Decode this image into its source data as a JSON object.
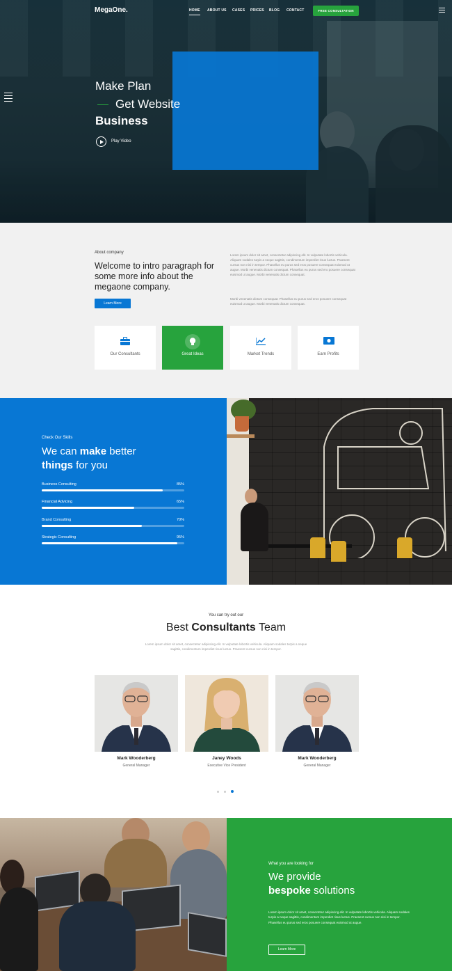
{
  "brand": {
    "logo": "MegaOne."
  },
  "nav": {
    "items": [
      "HOME",
      "ABOUT US",
      "CASES",
      "PRICES",
      "BLOG",
      "CONTACT"
    ],
    "cta": "FREE CONSULTATION"
  },
  "hero": {
    "line1": "Make Plan",
    "line2": "Get Website",
    "line3": "Business",
    "play_label": "Play Video"
  },
  "about": {
    "eyebrow": "About company",
    "heading": "Welcome to intro paragraph for some more info about the megaone company.",
    "button": "Learn More",
    "para1": "Lorem ipsum dolor sit amet, consectetur adipiscing elit. In vulputate lobortis vehicula. Aliquam sodales turpis a neque sagittis, condimentum imperdiet risus luctus. Praesent cursus non nisi in tempor. Phasellus eu purus sed eros posuere consequat euismod ut augue. Morbi venenatis dictum consequat. Phasellus eu purus sed ero posuere consequat euismod ut augue. Morbi venenatis dictum consequat.",
    "para2": "Morbi venenatis dictum consequat. Phasellus eu purus sed eros posuere consequat euismod ut augue. Morbi venenatis dictum consequat.",
    "cards": [
      "Our Consultants",
      "Great Ideas",
      "Market Trends",
      "Earn Profits"
    ]
  },
  "skills": {
    "eyebrow": "Check Our Skills",
    "heading_a": "We can ",
    "heading_b": "make",
    "heading_c": " better",
    "heading_d": "things",
    "heading_e": " for you",
    "items": [
      {
        "label": "Business Consulting",
        "percent": "85%",
        "value": 85
      },
      {
        "label": "Financial Advicing",
        "percent": "65%",
        "value": 65
      },
      {
        "label": "Brand Consulting",
        "percent": "70%",
        "value": 70
      },
      {
        "label": "Strategic Consulting",
        "percent": "95%",
        "value": 95
      }
    ]
  },
  "team": {
    "eyebrow": "You can try out our",
    "heading_a": "Best ",
    "heading_b": "Consultants",
    "heading_c": " Team",
    "desc": "Lorem ipsum dolor sit amet, consectetur adipiscing elit. In vulputate lobortis vehicula. Aliquam sodales turpis a neque sagittis, condimentum imperdiet risus luctus. Praesent cursus non nisi in tempor.",
    "members": [
      {
        "name": "Mark Wooderberg",
        "role": "General Manager"
      },
      {
        "name": "Janey Woods",
        "role": "Executive Vice President"
      },
      {
        "name": "Mark Wooderberg",
        "role": "General Manager"
      }
    ]
  },
  "bespoke": {
    "eyebrow": "What you are looking for",
    "heading_a": "We provide",
    "heading_b": "bespoke",
    "heading_c": " solutions",
    "para": "Lorem ipsum dolor sit amet, consectetur adipiscing elit. In vulputate lobortis vehicula. Aliquam sodales turpis a neque sagittis, condimentum imperdiet risus luctus. Praesent cursus non nisi in tempor. Phasellus eu purus sed eros posuere consequat euismod ut augue.",
    "button": "Learn More"
  },
  "colors": {
    "blue": "#0877d4",
    "green": "#27a33d"
  }
}
